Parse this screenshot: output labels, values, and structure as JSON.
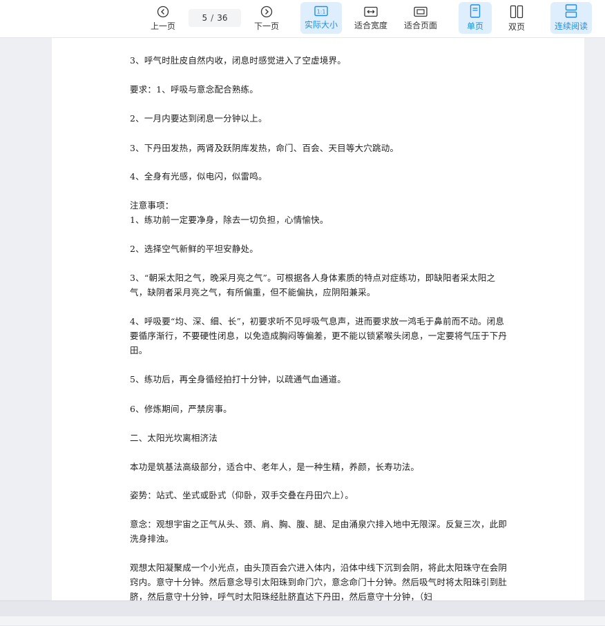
{
  "toolbar": {
    "prev_label": "上一页",
    "next_label": "下一页",
    "current_page": "5",
    "separator": "/",
    "total_pages": "36",
    "actual_size_label": "实际大小",
    "fit_width_label": "适合宽度",
    "fit_page_label": "适合页面",
    "single_page_label": "单页",
    "double_page_label": "双页",
    "continuous_label": "连续阅读",
    "accent_color": "#1f8ee6",
    "active_bg": "#deeefc"
  },
  "document": {
    "paragraphs": [
      "3、呼气时肚皮自然内收，闭息时感觉进入了空虚境界。",
      "要求：1、呼吸与意念配合熟练。",
      "2、一月内要达到闭息一分钟以上。",
      "3、下丹田发热，两肾及跃阴库发热，命门、百会、天目等大穴跳动。",
      "4、全身有光感，似电闪，似雷鸣。",
      "注意事项：",
      "1、练功前一定要净身，除去一切负担，心情愉快。",
      "2、选择空气新鲜的平坦安静处。",
      "3、“朝采太阳之气，晚采月亮之气”。可根据各人身体素质的特点对症练功，即缺阳者采太阳之气，缺阴者采月亮之气，有所偏重，但不能偏执，应阴阳兼采。",
      "4、呼吸要“均、深、细、长”，初要求听不见呼吸气息声，进而要求放一鸿毛于鼻前而不动。闭息要循序渐行，不要硬性闭息，以免造成胸闷等偏差，更不能以锁紧喉头闭息，一定要将气压于下丹田。",
      "5、练功后，再全身循经拍打十分钟，以疏通气血通道。",
      "6、修炼期间，严禁房事。",
      "二、太阳光坎离相济法",
      "本功是筑基法高级部分，适合中、老年人，是一种生精，养颜，长寿功法。",
      "姿势：站式、坐式或卧式（仰卧，双手交叠在丹田穴上）。",
      "意念：观想宇宙之正气从头、颈、肩、胸、腹、腿、足由涌泉穴排入地中无限深。反复三次，此即洗身排浊。",
      "观想太阳凝聚成一个小光点，由头顶百会穴进入体内，沿体中线下沉到会阴，将此太阳珠守在会阴窍内。意守十分钟。然后意念导引太阳珠到命门穴，意念命门十分钟。然后吸气时将太阳珠引到肚脐，然后意守十分钟，呼气时太阳珠经肚脐直达下丹田，然后意守十分钟，（妇"
    ]
  }
}
